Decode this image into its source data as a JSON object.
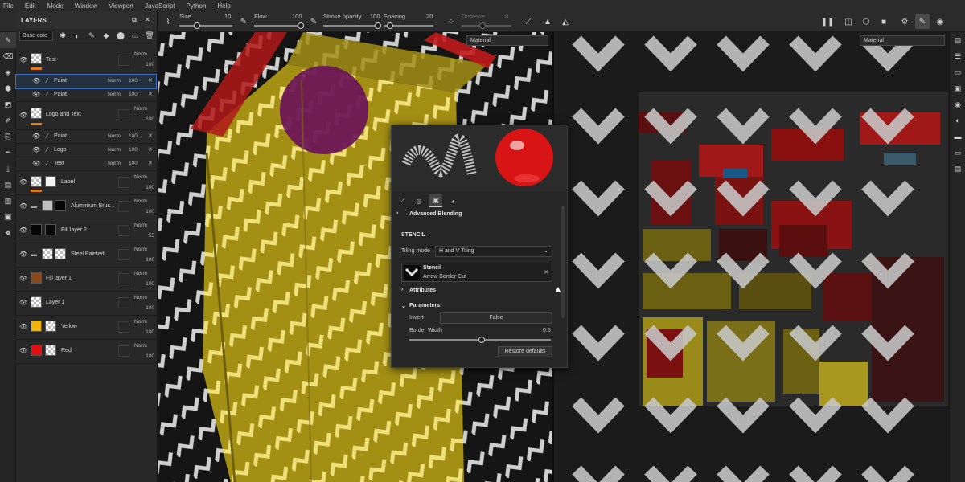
{
  "menu": [
    "File",
    "Edit",
    "Mode",
    "Window",
    "Viewport",
    "JavaScript",
    "Python",
    "Help"
  ],
  "toolbar": {
    "size_label": "Size",
    "size_value": "10",
    "flow_label": "Flow",
    "flow_value": "100",
    "stroke_opacity_label": "Stroke opacity",
    "stroke_opacity_value": "100",
    "spacing_label": "Spacing",
    "spacing_value": "20",
    "distance_label": "Distance",
    "distance_value": "8"
  },
  "layers_panel": {
    "title": "LAYERS",
    "channel_select": "Base colc",
    "layers": [
      {
        "name": "Test",
        "blend": "Norm",
        "opacity": "100",
        "type": "folder"
      },
      {
        "name": "Paint",
        "blend": "Norm",
        "opacity": "100",
        "type": "sub",
        "selected": true
      },
      {
        "name": "Paint",
        "blend": "Norm",
        "opacity": "100",
        "type": "sub"
      },
      {
        "name": "Logo and Text",
        "blend": "Norm",
        "opacity": "100",
        "type": "folder"
      },
      {
        "name": "Paint",
        "blend": "Norm",
        "opacity": "100",
        "type": "sub"
      },
      {
        "name": "Logo",
        "blend": "Norm",
        "opacity": "100",
        "type": "sub"
      },
      {
        "name": "Text",
        "blend": "Norm",
        "opacity": "100",
        "type": "sub"
      },
      {
        "name": "Label",
        "blend": "Norm",
        "opacity": "100",
        "type": "fill"
      },
      {
        "name": "Aluminium Brus...",
        "blend": "Norm",
        "opacity": "100",
        "type": "folder"
      },
      {
        "name": "Fill layer 2",
        "blend": "Norm",
        "opacity": "55",
        "type": "fill"
      },
      {
        "name": "Steel Painted",
        "blend": "Norm",
        "opacity": "100",
        "type": "folder"
      },
      {
        "name": "Fill layer 1",
        "blend": "Norm",
        "opacity": "100",
        "type": "fill"
      },
      {
        "name": "Layer 1",
        "blend": "Norm",
        "opacity": "100",
        "type": "fill"
      },
      {
        "name": "Yellow",
        "blend": "Norm",
        "opacity": "100",
        "type": "fill"
      },
      {
        "name": "Red",
        "blend": "Norm",
        "opacity": "100",
        "type": "fill"
      }
    ]
  },
  "viewport_3d": {
    "mode_select": "Material"
  },
  "viewport_2d": {
    "mode_select": "Material"
  },
  "properties": {
    "advanced_blending": "Advanced Blending",
    "stencil_header": "STENCIL",
    "tiling_mode_label": "Tiling mode",
    "tiling_mode_value": "H and V Tiling",
    "stencil_name": "Stencil",
    "stencil_resource": "Arrow Border Cut",
    "attributes": "Attributes",
    "parameters": "Parameters",
    "invert_label": "Invert",
    "invert_value": "False",
    "border_width_label": "Border Width",
    "border_width_value": "0.5",
    "restore_defaults": "Restore defaults"
  },
  "colors": {
    "accent_orange": "#e07b1a",
    "selection_blue": "#3a6fbf",
    "post_yellow": "#b9a21a",
    "sphere_red": "#d91414"
  }
}
